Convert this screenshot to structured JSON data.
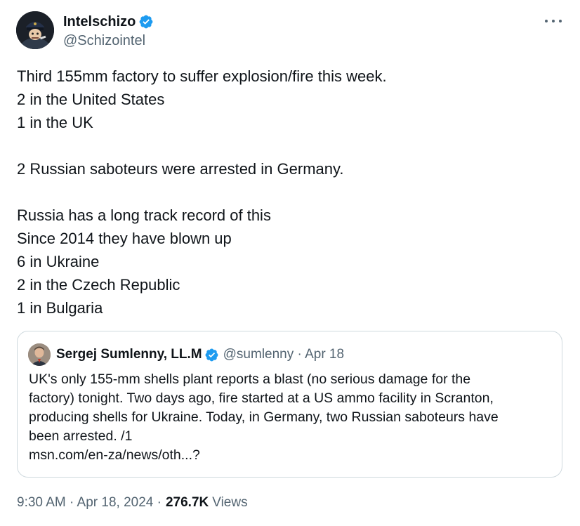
{
  "author": {
    "display_name": "Intelschizo",
    "handle": "@Schizointel",
    "verified": true
  },
  "tweet": {
    "lines": [
      "Third 155mm factory to suffer explosion/fire this week.",
      "2 in the United States",
      "1 in the UK",
      "",
      "2 Russian saboteurs were arrested in Germany.",
      "",
      "Russia has a long track record of this",
      "Since 2014 they have blown up",
      "6 in Ukraine",
      "2 in the Czech Republic",
      "1 in Bulgaria"
    ]
  },
  "quote": {
    "display_name": "Sergej Sumlenny, LL.M",
    "handle_date": "@sumlenny · Apr 18",
    "lines": [
      "UK's only 155-mm shells plant reports a blast (no serious damage for the",
      "factory) tonight. Two days ago, fire started at a US ammo facility in Scranton,",
      "producing shells for Ukraine. Today, in Germany, two Russian saboteurs have",
      "been arrested. /1",
      "msn.com/en-za/news/oth...?"
    ]
  },
  "footer": {
    "timestamp": "9:30 AM · Apr 18, 2024 ·",
    "views_count": "276.7K",
    "views_label": "Views"
  },
  "icons": {
    "verified": "verified-badge-icon",
    "more": "more-options-icon"
  },
  "colors": {
    "verified_blue": "#1d9bf0",
    "secondary_text": "#536471",
    "border": "#cfd9de"
  }
}
